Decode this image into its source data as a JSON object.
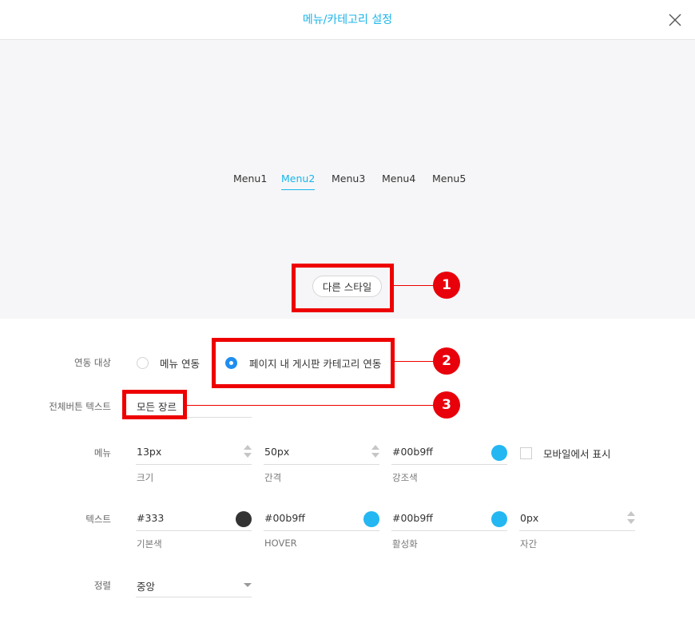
{
  "header": {
    "title": "메뉴/카테고리 설정"
  },
  "preview": {
    "menu_items": [
      "Menu1",
      "Menu2",
      "Menu3",
      "Menu4",
      "Menu5"
    ],
    "active_menu": "Menu2",
    "style_button": "다른 스타일"
  },
  "annotations": [
    "1",
    "2",
    "3"
  ],
  "settings": {
    "link_target": {
      "label": "연동 대상",
      "options": [
        "메뉴 연동",
        "페이지 내 게시판 카테고리 연동"
      ],
      "selected": "페이지 내 게시판 카테고리 연동"
    },
    "all_button_text": {
      "label": "전체버튼 텍스트",
      "value": "모든 장르"
    },
    "menu": {
      "label": "메뉴",
      "size": {
        "value": "13px",
        "caption": "크기"
      },
      "spacing": {
        "value": "50px",
        "caption": "간격"
      },
      "accent": {
        "value": "#00b9ff",
        "caption": "강조색",
        "color": "#24b7f2"
      },
      "mobile_display": {
        "label": "모바일에서 표시",
        "checked": false
      }
    },
    "text": {
      "label": "텍스트",
      "base": {
        "value": "#333",
        "caption": "기본색",
        "color": "#333333"
      },
      "hover": {
        "value": "#00b9ff",
        "caption": "HOVER",
        "color": "#24b7f2"
      },
      "active": {
        "value": "#00b9ff",
        "caption": "활성화",
        "color": "#24b7f2"
      },
      "letter_spacing": {
        "value": "0px",
        "caption": "자간"
      }
    },
    "align": {
      "label": "정렬",
      "value": "중앙"
    }
  },
  "colors": {
    "accent": "#1ab4e8",
    "highlight": "#ee0000",
    "radio": "#1e8ef0"
  }
}
